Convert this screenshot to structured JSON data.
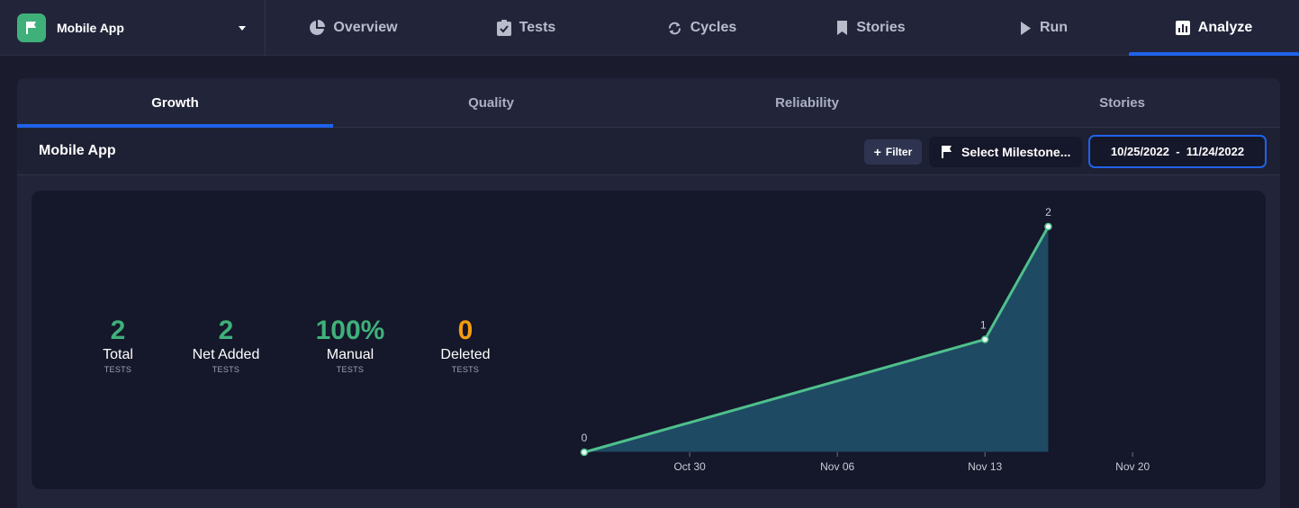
{
  "project": {
    "name": "Mobile App",
    "logo_icon": "flag-icon",
    "accent": "#3fb07a"
  },
  "nav": {
    "tabs": [
      {
        "label": "Overview",
        "icon": "pie-chart-icon"
      },
      {
        "label": "Tests",
        "icon": "clipboard-check-icon"
      },
      {
        "label": "Cycles",
        "icon": "refresh-icon"
      },
      {
        "label": "Stories",
        "icon": "bookmark-icon"
      },
      {
        "label": "Run",
        "icon": "play-icon"
      },
      {
        "label": "Analyze",
        "icon": "bar-chart-icon",
        "active": true
      }
    ]
  },
  "subtabs": [
    {
      "label": "Growth",
      "active": true
    },
    {
      "label": "Quality"
    },
    {
      "label": "Reliability"
    },
    {
      "label": "Stories"
    }
  ],
  "toolbar": {
    "title": "Mobile App",
    "filter_label": "Filter",
    "milestone_label": "Select Milestone...",
    "date_range": "10/25/2022  -  11/24/2022"
  },
  "stats": [
    {
      "value": "2",
      "label": "Total",
      "sub": "TESTS",
      "color": "#3fb07a"
    },
    {
      "value": "2",
      "label": "Net Added",
      "sub": "TESTS",
      "color": "#3fb07a"
    },
    {
      "value": "100%",
      "label": "Manual",
      "sub": "TESTS",
      "color": "#3fb07a"
    },
    {
      "value": "0",
      "label": "Deleted",
      "sub": "TESTS",
      "color": "#f39c12"
    }
  ],
  "chart_data": {
    "type": "area",
    "x": [
      "2022-10-25",
      "2022-11-13",
      "2022-11-16"
    ],
    "values": [
      0,
      1,
      2
    ],
    "data_labels": [
      "0",
      "1",
      "2"
    ],
    "x_ticks": [
      "Oct 30",
      "Nov 06",
      "Nov 13",
      "Nov 20"
    ],
    "ylim": [
      0,
      2
    ],
    "grid": false,
    "line_color": "#4fc08d",
    "fill_color": "#1e4a63"
  },
  "colors": {
    "accent_blue": "#1f63ea",
    "background": "#1a1c2e",
    "panel": "#22253a"
  }
}
